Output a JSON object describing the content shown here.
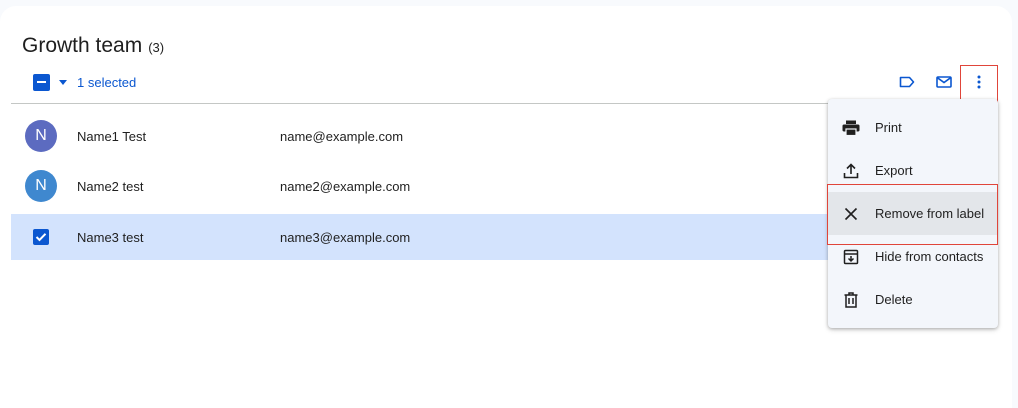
{
  "header": {
    "title": "Growth team",
    "count": "(3)"
  },
  "selection": {
    "text": "1 selected"
  },
  "toolbar": {
    "icons": [
      "label-icon",
      "email-icon",
      "more-vert-icon"
    ]
  },
  "contacts": [
    {
      "initial": "N",
      "name": "Name1 Test",
      "email": "name@example.com",
      "avatar_color": "#5c6bc0",
      "selected": false
    },
    {
      "initial": "N",
      "name": "Name2 test",
      "email": "name2@example.com",
      "avatar_color": "#3f88cf",
      "selected": false
    },
    {
      "initial": "",
      "name": "Name3 test",
      "email": "name3@example.com",
      "avatar_color": "",
      "selected": true
    }
  ],
  "menu": {
    "items": [
      {
        "label": "Print",
        "icon": "print-icon"
      },
      {
        "label": "Export",
        "icon": "export-icon"
      },
      {
        "label": "Remove from label",
        "icon": "close-icon"
      },
      {
        "label": "Hide from contacts",
        "icon": "archive-icon"
      },
      {
        "label": "Delete",
        "icon": "trash-icon"
      }
    ]
  },
  "colors": {
    "accent": "#0b57d0",
    "selected_row": "#d3e3fd",
    "highlight": "#e0453a"
  }
}
